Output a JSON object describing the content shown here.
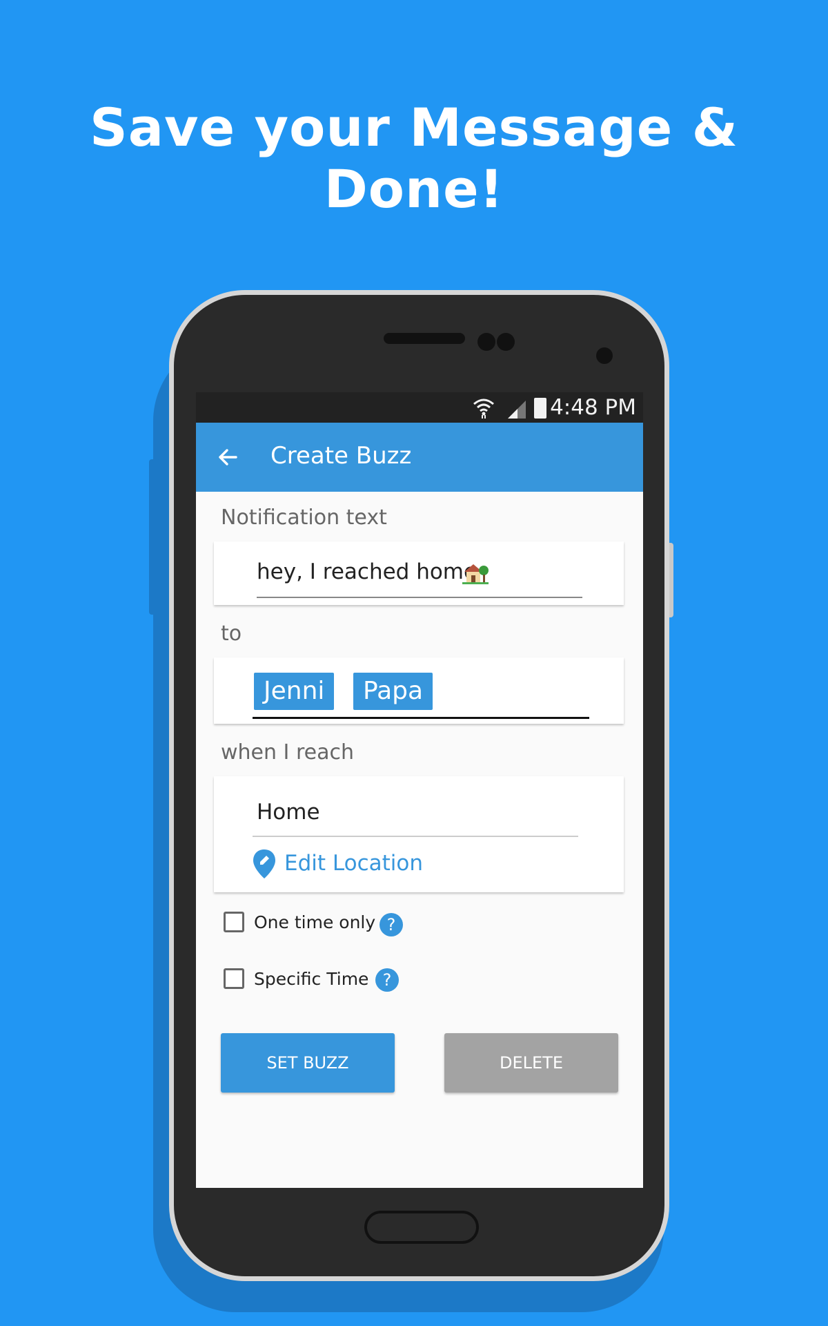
{
  "headline": "Save your Message & Done!",
  "status_bar": {
    "time": "4:48 PM"
  },
  "app_bar": {
    "title": "Create Buzz",
    "back_icon": "arrow-left-icon"
  },
  "form": {
    "notification_label": "Notification text",
    "notification_value": "hey, I reached home",
    "notification_emoji_icon": "house-with-garden-icon",
    "to_label": "to",
    "recipients": [
      "Jenni",
      "Papa"
    ],
    "when_label": "when I reach",
    "location_value": "Home",
    "edit_location_label": "Edit Location",
    "one_time_label": "One time only",
    "one_time_checked": false,
    "specific_time_label": "Specific Time",
    "specific_time_checked": false,
    "help_glyph": "?"
  },
  "buttons": {
    "set_buzz": "SET BUZZ",
    "delete": "DELETE"
  },
  "colors": {
    "background": "#2196F3",
    "accent": "#3796DC",
    "delete_button": "#A3A3A3"
  }
}
